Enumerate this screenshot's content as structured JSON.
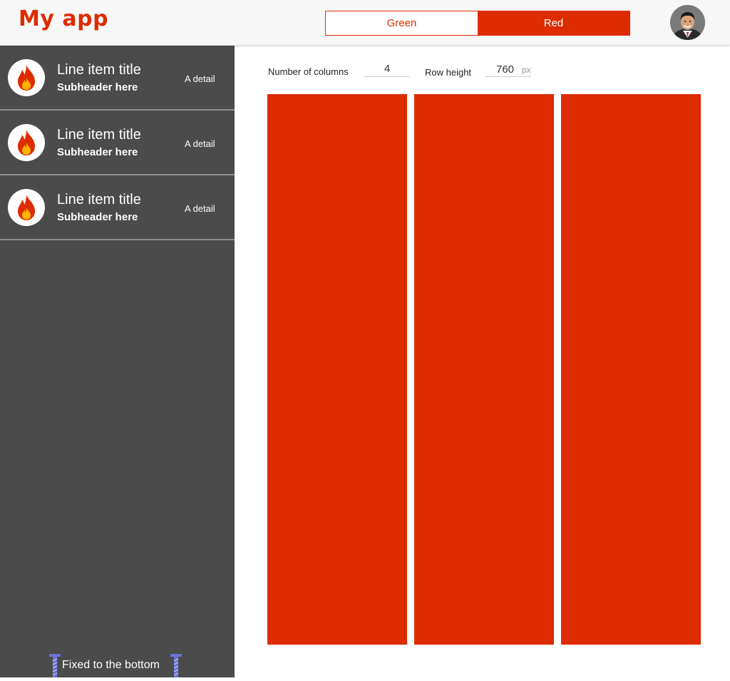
{
  "header": {
    "logo_text": "My app",
    "toggle": {
      "options": [
        "Green",
        "Red"
      ],
      "selected": "Red"
    },
    "avatar": "user-avatar"
  },
  "sidebar": {
    "items": [
      {
        "icon": "fire-icon",
        "title": "Line item title",
        "subheader": "Subheader here",
        "detail": "A detail"
      },
      {
        "icon": "fire-icon",
        "title": "Line item title",
        "subheader": "Subheader here",
        "detail": "A detail"
      },
      {
        "icon": "fire-icon",
        "title": "Line item title",
        "subheader": "Subheader here",
        "detail": "A detail"
      }
    ],
    "footer": {
      "text": "Fixed to the bottom",
      "icon": "screw-icon"
    }
  },
  "main": {
    "columns_label": "Number of columns",
    "columns_value": "4",
    "row_height_label": "Row height",
    "row_height_value": "760",
    "row_height_unit": "px",
    "grid_columns": 3
  },
  "colors": {
    "accent": "#dd2c00",
    "sidebar_bg": "#4b4b4b",
    "header_bg": "#f7f7f7",
    "screw": "#6b72d6"
  }
}
